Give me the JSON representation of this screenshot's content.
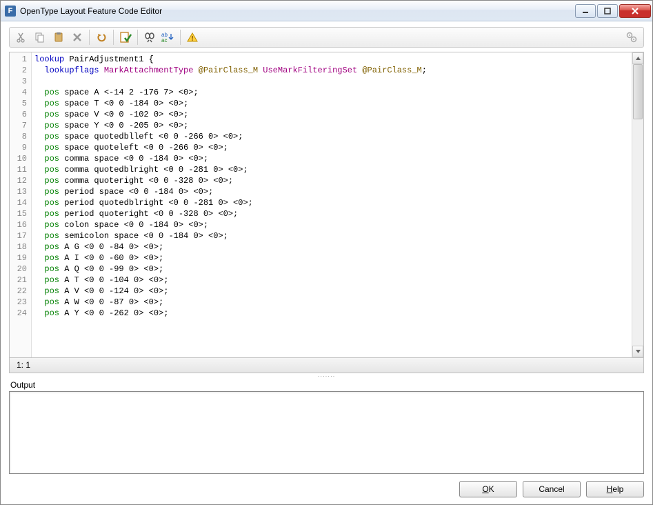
{
  "window": {
    "title": "OpenType Layout Feature Code Editor"
  },
  "toolbar_icons": [
    "cut",
    "copy",
    "paste",
    "delete",
    "undo",
    "validate",
    "find",
    "replace",
    "warning",
    "settings"
  ],
  "code": {
    "lines": [
      {
        "n": 1,
        "tokens": [
          {
            "t": "lookup",
            "c": "kw"
          },
          {
            "t": " PairAdjustment1 {"
          }
        ]
      },
      {
        "n": 2,
        "tokens": [
          {
            "t": "  "
          },
          {
            "t": "lookupflags",
            "c": "kw"
          },
          {
            "t": " "
          },
          {
            "t": "MarkAttachmentType",
            "c": "flag"
          },
          {
            "t": " "
          },
          {
            "t": "@PairClass_M",
            "c": "cls"
          },
          {
            "t": " "
          },
          {
            "t": "UseMarkFilteringSet",
            "c": "flag"
          },
          {
            "t": " "
          },
          {
            "t": "@PairClass_M",
            "c": "cls"
          },
          {
            "t": ";"
          }
        ]
      },
      {
        "n": 3,
        "tokens": []
      },
      {
        "n": 4,
        "tokens": [
          {
            "t": "  "
          },
          {
            "t": "pos",
            "c": "pos"
          },
          {
            "t": " space A <-14 2 -176 7> <0>;"
          }
        ]
      },
      {
        "n": 5,
        "tokens": [
          {
            "t": "  "
          },
          {
            "t": "pos",
            "c": "pos"
          },
          {
            "t": " space T <0 0 -184 0> <0>;"
          }
        ]
      },
      {
        "n": 6,
        "tokens": [
          {
            "t": "  "
          },
          {
            "t": "pos",
            "c": "pos"
          },
          {
            "t": " space V <0 0 -102 0> <0>;"
          }
        ]
      },
      {
        "n": 7,
        "tokens": [
          {
            "t": "  "
          },
          {
            "t": "pos",
            "c": "pos"
          },
          {
            "t": " space Y <0 0 -205 0> <0>;"
          }
        ]
      },
      {
        "n": 8,
        "tokens": [
          {
            "t": "  "
          },
          {
            "t": "pos",
            "c": "pos"
          },
          {
            "t": " space quotedblleft <0 0 -266 0> <0>;"
          }
        ]
      },
      {
        "n": 9,
        "tokens": [
          {
            "t": "  "
          },
          {
            "t": "pos",
            "c": "pos"
          },
          {
            "t": " space quoteleft <0 0 -266 0> <0>;"
          }
        ]
      },
      {
        "n": 10,
        "tokens": [
          {
            "t": "  "
          },
          {
            "t": "pos",
            "c": "pos"
          },
          {
            "t": " comma space <0 0 -184 0> <0>;"
          }
        ]
      },
      {
        "n": 11,
        "tokens": [
          {
            "t": "  "
          },
          {
            "t": "pos",
            "c": "pos"
          },
          {
            "t": " comma quotedblright <0 0 -281 0> <0>;"
          }
        ]
      },
      {
        "n": 12,
        "tokens": [
          {
            "t": "  "
          },
          {
            "t": "pos",
            "c": "pos"
          },
          {
            "t": " comma quoteright <0 0 -328 0> <0>;"
          }
        ]
      },
      {
        "n": 13,
        "tokens": [
          {
            "t": "  "
          },
          {
            "t": "pos",
            "c": "pos"
          },
          {
            "t": " period space <0 0 -184 0> <0>;"
          }
        ]
      },
      {
        "n": 14,
        "tokens": [
          {
            "t": "  "
          },
          {
            "t": "pos",
            "c": "pos"
          },
          {
            "t": " period quotedblright <0 0 -281 0> <0>;"
          }
        ]
      },
      {
        "n": 15,
        "tokens": [
          {
            "t": "  "
          },
          {
            "t": "pos",
            "c": "pos"
          },
          {
            "t": " period quoteright <0 0 -328 0> <0>;"
          }
        ]
      },
      {
        "n": 16,
        "tokens": [
          {
            "t": "  "
          },
          {
            "t": "pos",
            "c": "pos"
          },
          {
            "t": " colon space <0 0 -184 0> <0>;"
          }
        ]
      },
      {
        "n": 17,
        "tokens": [
          {
            "t": "  "
          },
          {
            "t": "pos",
            "c": "pos"
          },
          {
            "t": " semicolon space <0 0 -184 0> <0>;"
          }
        ]
      },
      {
        "n": 18,
        "tokens": [
          {
            "t": "  "
          },
          {
            "t": "pos",
            "c": "pos"
          },
          {
            "t": " A G <0 0 -84 0> <0>;"
          }
        ]
      },
      {
        "n": 19,
        "tokens": [
          {
            "t": "  "
          },
          {
            "t": "pos",
            "c": "pos"
          },
          {
            "t": " A I <0 0 -60 0> <0>;"
          }
        ]
      },
      {
        "n": 20,
        "tokens": [
          {
            "t": "  "
          },
          {
            "t": "pos",
            "c": "pos"
          },
          {
            "t": " A Q <0 0 -99 0> <0>;"
          }
        ]
      },
      {
        "n": 21,
        "tokens": [
          {
            "t": "  "
          },
          {
            "t": "pos",
            "c": "pos"
          },
          {
            "t": " A T <0 0 -104 0> <0>;"
          }
        ]
      },
      {
        "n": 22,
        "tokens": [
          {
            "t": "  "
          },
          {
            "t": "pos",
            "c": "pos"
          },
          {
            "t": " A V <0 0 -124 0> <0>;"
          }
        ]
      },
      {
        "n": 23,
        "tokens": [
          {
            "t": "  "
          },
          {
            "t": "pos",
            "c": "pos"
          },
          {
            "t": " A W <0 0 -87 0> <0>;"
          }
        ]
      },
      {
        "n": 24,
        "tokens": [
          {
            "t": "  "
          },
          {
            "t": "pos",
            "c": "pos"
          },
          {
            "t": " A Y <0 0 -262 0> <0>;"
          }
        ]
      }
    ]
  },
  "status": {
    "position": "1: 1"
  },
  "output": {
    "label": "Output"
  },
  "buttons": {
    "ok": "OK",
    "cancel": "Cancel",
    "help": "Help"
  }
}
